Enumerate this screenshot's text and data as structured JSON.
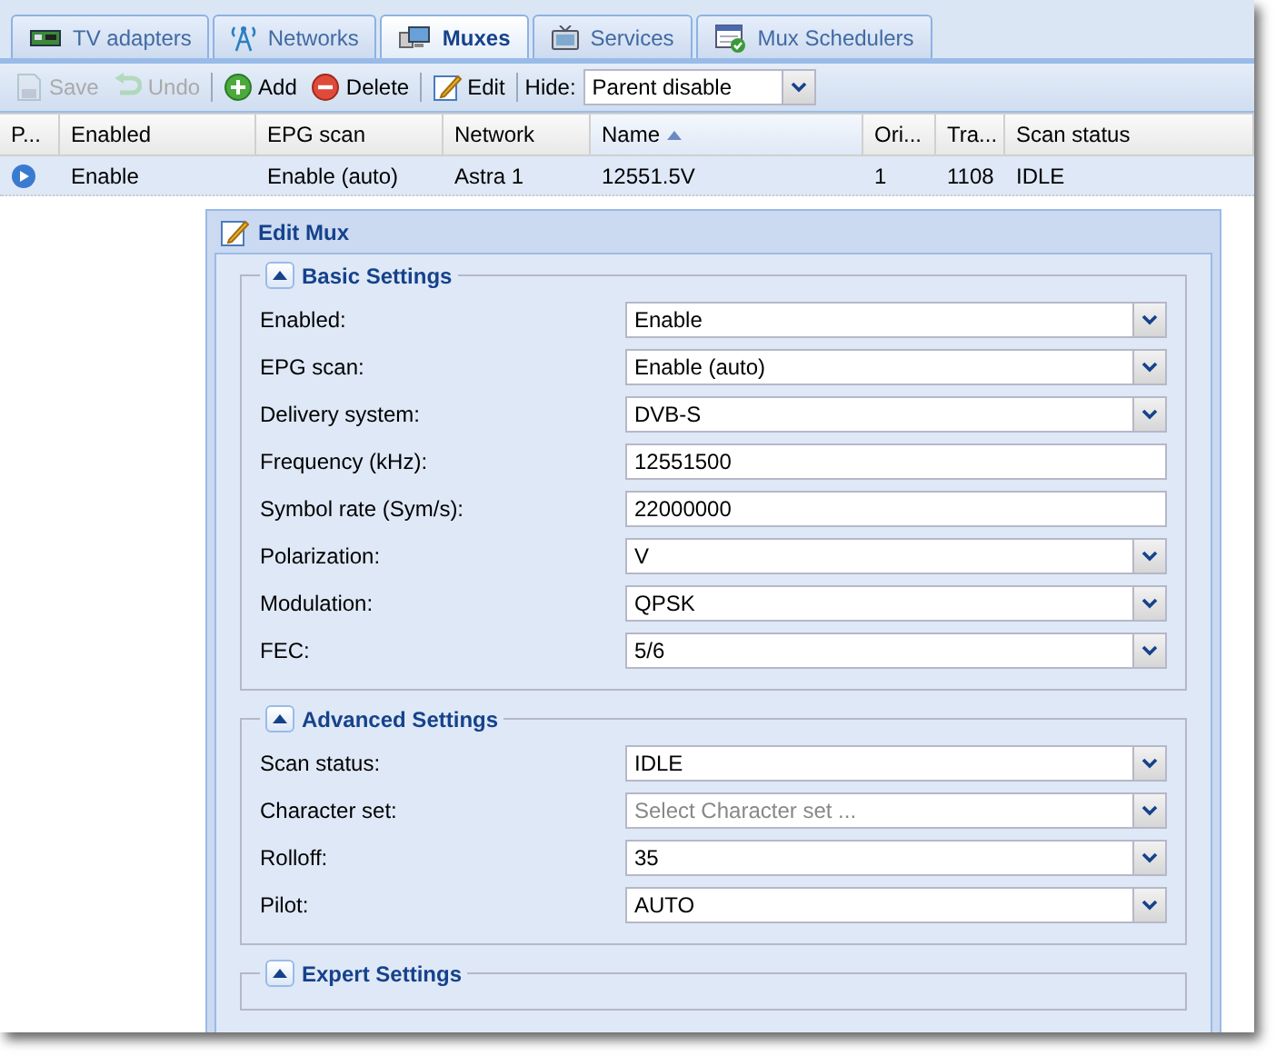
{
  "tabs": [
    {
      "label": "TV adapters",
      "selected": false
    },
    {
      "label": "Networks",
      "selected": false
    },
    {
      "label": "Muxes",
      "selected": true
    },
    {
      "label": "Services",
      "selected": false
    },
    {
      "label": "Mux Schedulers",
      "selected": false
    }
  ],
  "toolbar": {
    "buttons": [
      {
        "label": "Save",
        "disabled": true
      },
      {
        "label": "Undo",
        "disabled": true
      },
      {
        "label": "Add",
        "disabled": false
      },
      {
        "label": "Delete",
        "disabled": false
      },
      {
        "label": "Edit",
        "disabled": false
      }
    ],
    "hide_label": "Hide:",
    "hide_value": "Parent disable"
  },
  "table": {
    "columns": [
      {
        "label": "P...",
        "sorted": false
      },
      {
        "label": "Enabled",
        "sorted": false
      },
      {
        "label": "EPG scan",
        "sorted": false
      },
      {
        "label": "Network",
        "sorted": false
      },
      {
        "label": "Name",
        "sorted": true
      },
      {
        "label": "Ori...",
        "sorted": false
      },
      {
        "label": "Tra...",
        "sorted": false
      },
      {
        "label": "Scan status",
        "sorted": false
      }
    ],
    "rows": [
      {
        "selected": true,
        "cells": [
          "",
          "Enable",
          "Enable (auto)",
          "Astra 1",
          "12551.5V",
          "1",
          "1108",
          "IDLE"
        ]
      }
    ]
  },
  "dialog": {
    "title": "Edit Mux",
    "sections": [
      {
        "title": "Basic Settings",
        "expanded": true,
        "fields": [
          {
            "label": "Enabled:",
            "kind": "select",
            "value": "Enable"
          },
          {
            "label": "EPG scan:",
            "kind": "select",
            "value": "Enable (auto)"
          },
          {
            "label": "Delivery system:",
            "kind": "select",
            "value": "DVB-S"
          },
          {
            "label": "Frequency (kHz):",
            "kind": "text",
            "value": "12551500"
          },
          {
            "label": "Symbol rate (Sym/s):",
            "kind": "text",
            "value": "22000000"
          },
          {
            "label": "Polarization:",
            "kind": "select",
            "value": "V"
          },
          {
            "label": "Modulation:",
            "kind": "select",
            "value": "QPSK"
          },
          {
            "label": "FEC:",
            "kind": "select",
            "value": "5/6"
          }
        ]
      },
      {
        "title": "Advanced Settings",
        "expanded": true,
        "fields": [
          {
            "label": "Scan status:",
            "kind": "select",
            "value": "IDLE"
          },
          {
            "label": "Character set:",
            "kind": "select",
            "placeholder": "Select Character set ..."
          },
          {
            "label": "Rolloff:",
            "kind": "select",
            "value": "35"
          },
          {
            "label": "Pilot:",
            "kind": "select",
            "value": "AUTO"
          }
        ]
      },
      {
        "title": "Expert Settings",
        "expanded": true
      }
    ]
  }
}
